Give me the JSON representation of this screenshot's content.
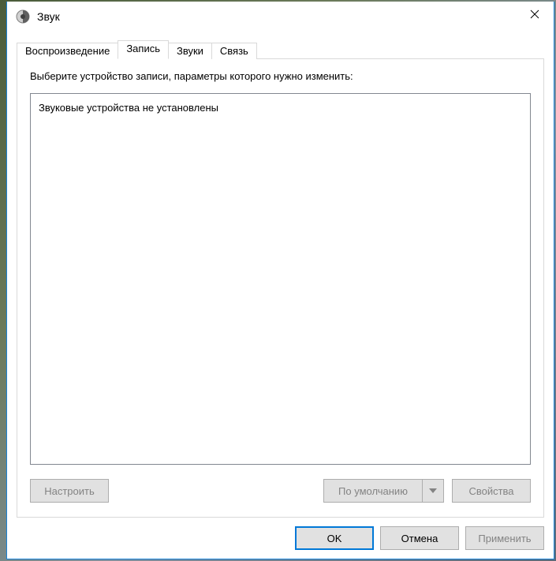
{
  "window": {
    "title": "Звук"
  },
  "tabs": [
    {
      "id": "playback",
      "label": "Воспроизведение",
      "active": false
    },
    {
      "id": "recording",
      "label": "Запись",
      "active": true
    },
    {
      "id": "sounds",
      "label": "Звуки",
      "active": false
    },
    {
      "id": "comm",
      "label": "Связь",
      "active": false
    }
  ],
  "panel": {
    "instruction": "Выберите устройство записи, параметры которого нужно изменить:",
    "empty_message": "Звуковые устройства не установлены",
    "buttons": {
      "configure": "Настроить",
      "set_default": "По умолчанию",
      "properties": "Свойства"
    }
  },
  "dialog_buttons": {
    "ok": "OK",
    "cancel": "Отмена",
    "apply": "Применить"
  }
}
